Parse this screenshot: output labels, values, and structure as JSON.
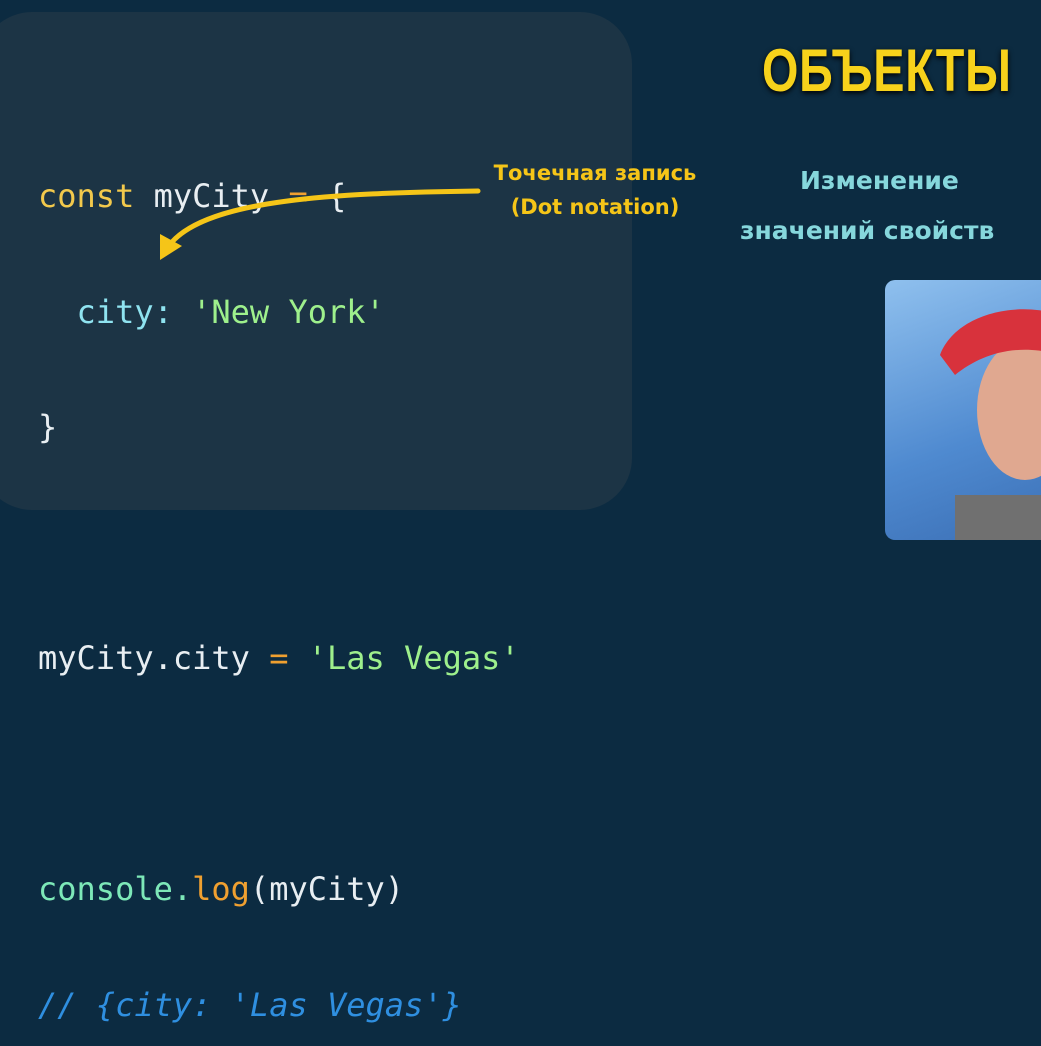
{
  "slide": {
    "title": "ОБЪЕКТЫ",
    "subtitle_line1": "Изменение",
    "subtitle_line2": "значений свойств",
    "annotation_line1": "Точечная запись",
    "annotation_line2": "(Dot notation)"
  },
  "code": {
    "l1_kw": "const",
    "l1_name": " myCity ",
    "l1_op": "=",
    "l1_brace": " {",
    "l2_indent": "  ",
    "l2_prop": "city:",
    "l2_str": " 'New York'",
    "l3": "}",
    "l5_obj": "myCity",
    "l5_dot": ".",
    "l5_prop": "city ",
    "l5_op": "=",
    "l5_str": " 'Las Vegas'",
    "l7_obj": "console.",
    "l7_fn": "log",
    "l7_args": "(myCity)",
    "l8_comment": "// {city: 'Las Vegas'}"
  },
  "colors": {
    "background": "#0c2b41",
    "panel": "#1c3445",
    "accent": "#f7d21b",
    "subtitle": "#86d7dc"
  }
}
